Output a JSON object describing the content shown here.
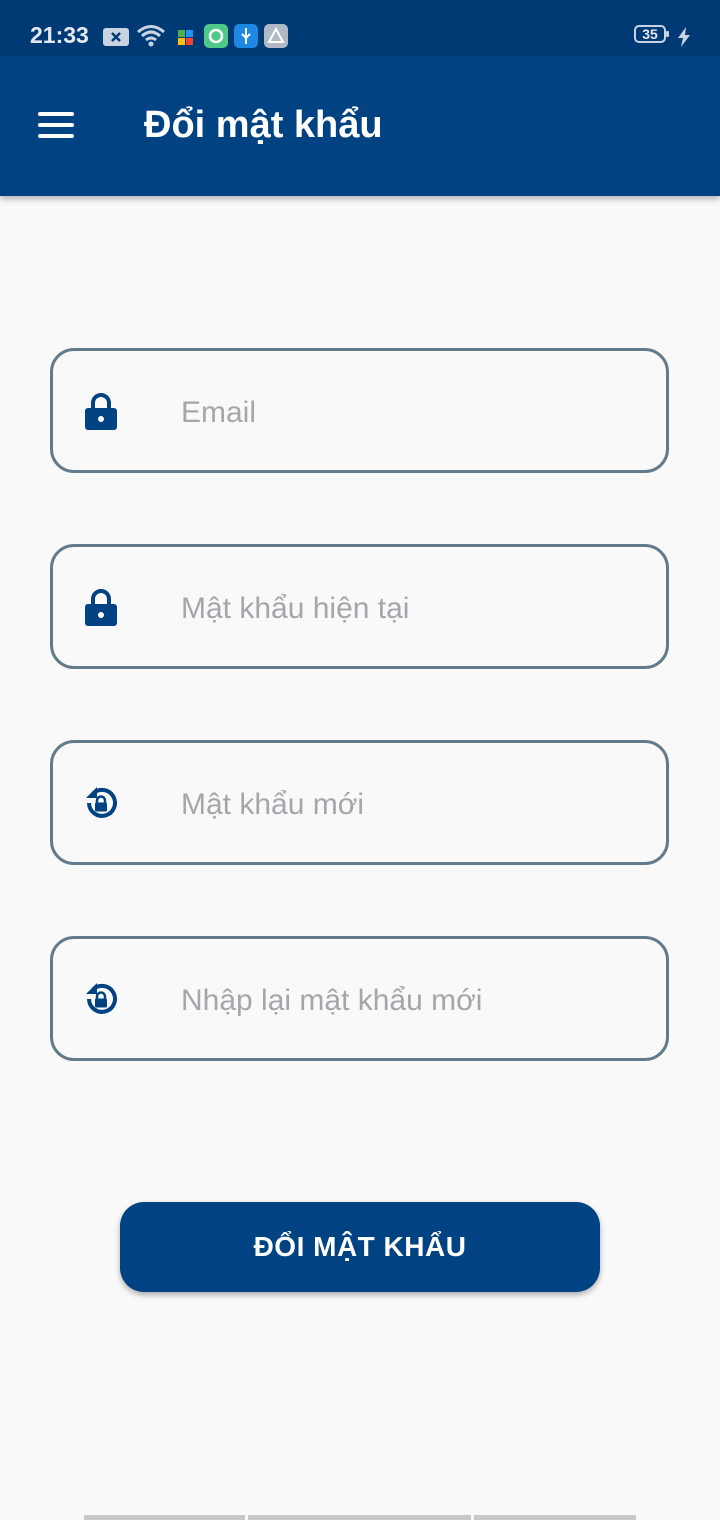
{
  "status_bar": {
    "time": "21:33",
    "battery": "35"
  },
  "app_bar": {
    "title": "Đổi mật khẩu"
  },
  "form": {
    "email_placeholder": "Email",
    "current_password_placeholder": "Mật khẩu hiện tại",
    "new_password_placeholder": "Mật khẩu mới",
    "confirm_password_placeholder": "Nhập lại mật khẩu mới"
  },
  "submit_label": "ĐỔI MẬT KHẨU",
  "colors": {
    "primary": "#004282",
    "status_bar": "#003a75",
    "field_border": "#627a8a",
    "placeholder": "#a3a6aa",
    "background": "#f9f9fa"
  }
}
